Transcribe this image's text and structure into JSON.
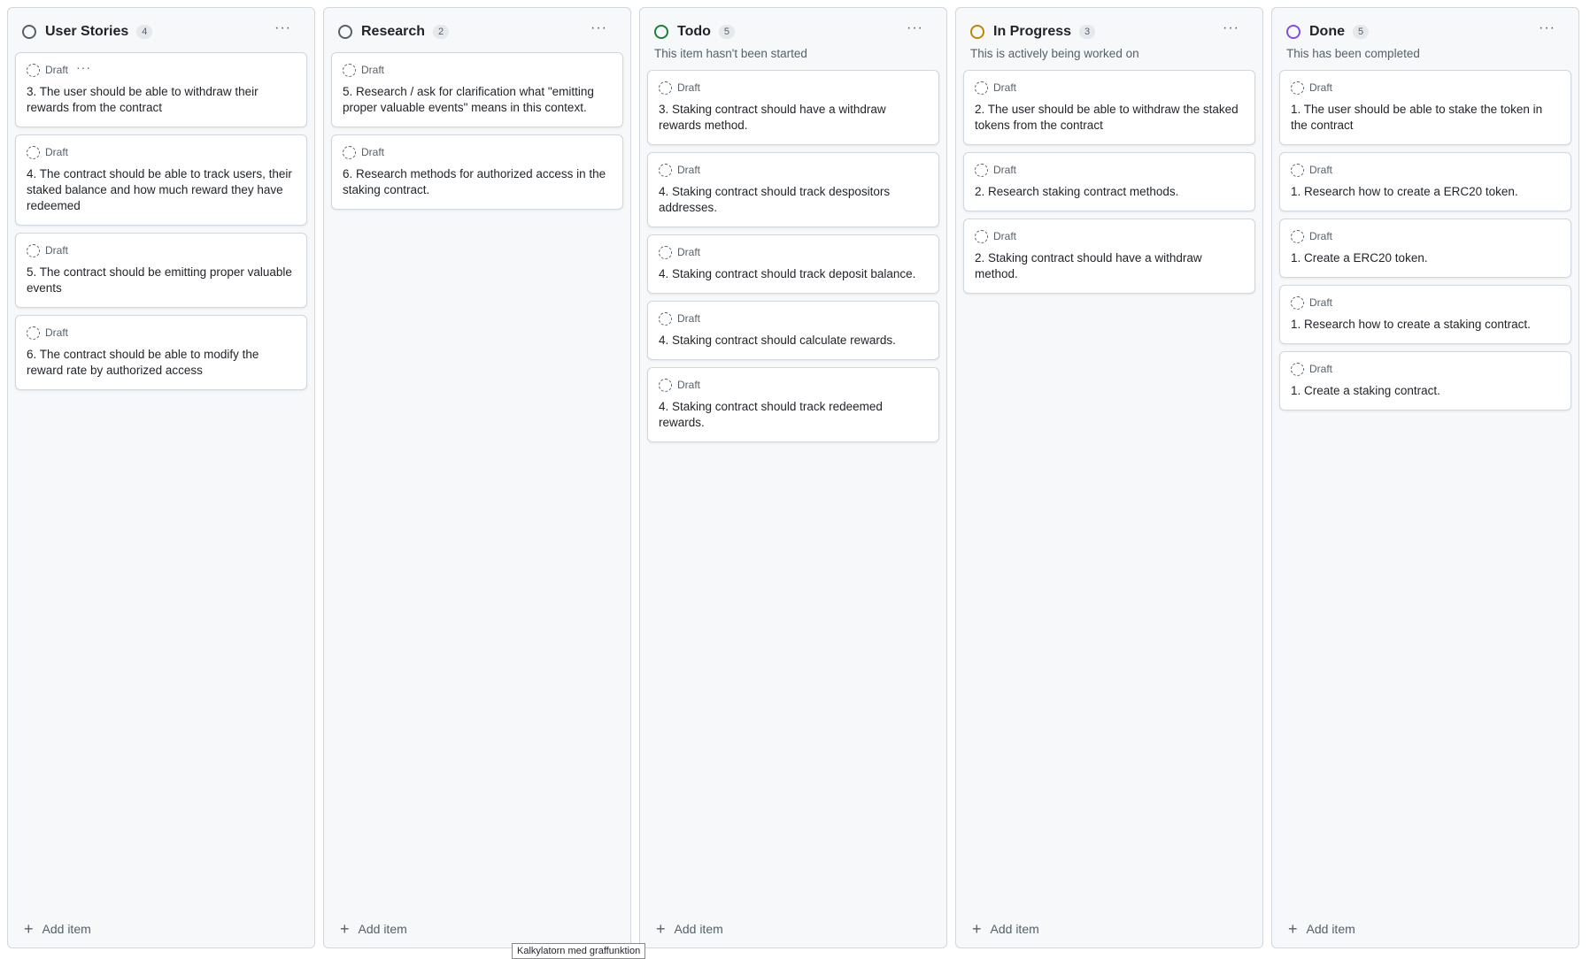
{
  "colors": {
    "gray": "#57606a",
    "green": "#1a7f37",
    "yellow": "#bf8700",
    "purple": "#8250df"
  },
  "add_item_label": "Add item",
  "columns": [
    {
      "title": "User Stories",
      "count": "4",
      "description": "",
      "status_color": "#57606a",
      "cards": [
        {
          "status": "Draft",
          "text": "3. The user should be able to withdraw their rewards from the contract",
          "menu": "···"
        },
        {
          "status": "Draft",
          "text": "4. The contract should be able to track users, their staked balance and how much reward they have redeemed"
        },
        {
          "status": "Draft",
          "text": "5. The contract should be emitting proper valuable events"
        },
        {
          "status": "Draft",
          "text": "6. The contract should be able to modify the reward rate by authorized access"
        }
      ]
    },
    {
      "title": "Research",
      "count": "2",
      "description": "",
      "status_color": "#57606a",
      "cards": [
        {
          "status": "Draft",
          "text": "5. Research / ask for clarification what \"emitting proper valuable events\" means in this context."
        },
        {
          "status": "Draft",
          "text": "6. Research methods for authorized access in the staking contract."
        }
      ]
    },
    {
      "title": "Todo",
      "count": "5",
      "description": "This item hasn't been started",
      "status_color": "#1a7f37",
      "cards": [
        {
          "status": "Draft",
          "text": "3. Staking contract should have a withdraw rewards method."
        },
        {
          "status": "Draft",
          "text": "4. Staking contract should track despositors addresses."
        },
        {
          "status": "Draft",
          "text": "4. Staking contract should track deposit balance."
        },
        {
          "status": "Draft",
          "text": "4. Staking contract should calculate rewards."
        },
        {
          "status": "Draft",
          "text": "4. Staking contract should track redeemed rewards."
        }
      ]
    },
    {
      "title": "In Progress",
      "count": "3",
      "description": "This is actively being worked on",
      "status_color": "#bf8700",
      "cards": [
        {
          "status": "Draft",
          "text": "2. The user should be able to withdraw the staked tokens from the contract"
        },
        {
          "status": "Draft",
          "text": "2. Research staking contract methods."
        },
        {
          "status": "Draft",
          "text": "2. Staking contract should have a withdraw method."
        }
      ]
    },
    {
      "title": "Done",
      "count": "5",
      "description": "This has been completed",
      "status_color": "#8250df",
      "cards": [
        {
          "status": "Draft",
          "text": "1. The user should be able to stake the token in the contract"
        },
        {
          "status": "Draft",
          "text": "1. Research how to create a ERC20 token."
        },
        {
          "status": "Draft",
          "text": "1. Create a ERC20 token."
        },
        {
          "status": "Draft",
          "text": "1. Research how to create a staking contract."
        },
        {
          "status": "Draft",
          "text": "1. Create a staking contract."
        }
      ]
    }
  ],
  "tooltip": "Kalkylatorn med graffunktion"
}
